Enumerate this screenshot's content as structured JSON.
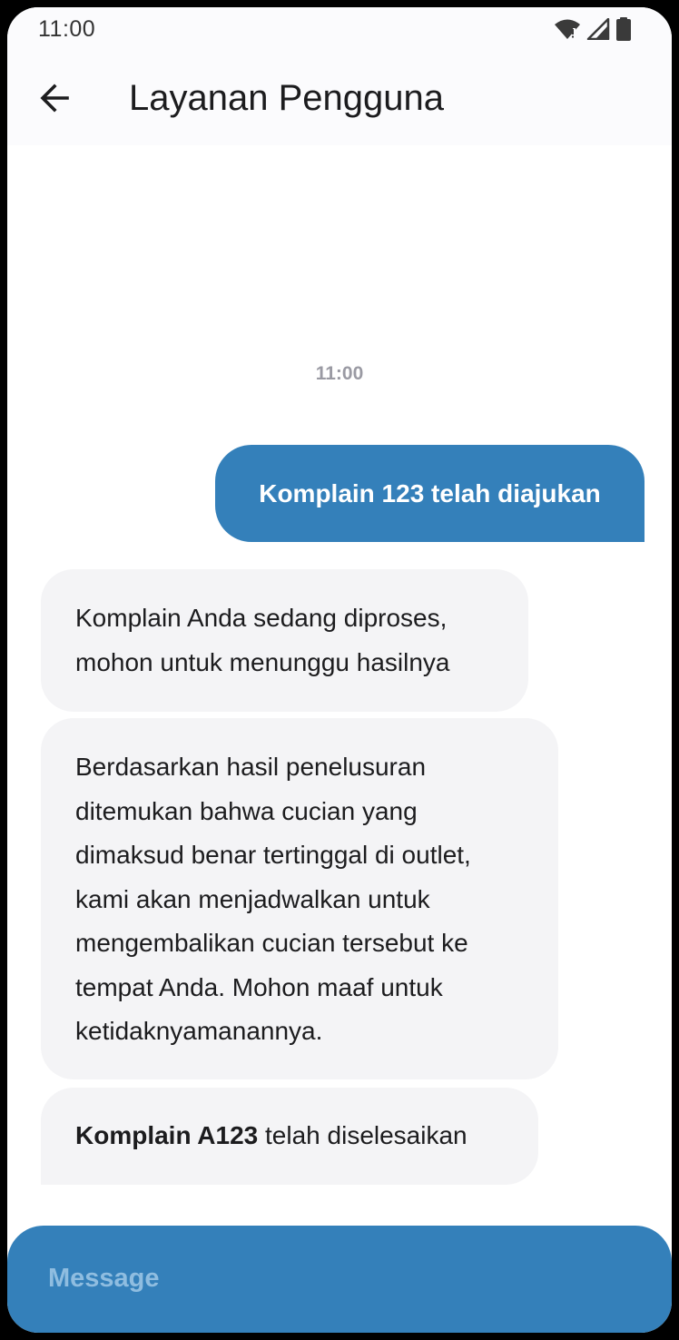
{
  "status_bar": {
    "time": "11:00",
    "icons": [
      "wifi-icon",
      "signal-icon",
      "battery-icon"
    ]
  },
  "app_bar": {
    "back_icon": "arrow-left-icon",
    "title": "Layanan Pengguna"
  },
  "chat": {
    "timestamp": "11:00",
    "outgoing": [
      {
        "text": "Komplain 123 telah diajukan"
      }
    ],
    "incoming": [
      {
        "lines": [
          "Komplain Anda sedang diproses,",
          "mohon untuk menunggu hasilnya"
        ]
      },
      {
        "lines": [
          "Berdasarkan hasil penelusuran",
          "ditemukan bahwa cucian yang",
          "dimaksud benar tertinggal di outlet,",
          "kami akan menjadwalkan untuk",
          "mengembalikan cucian tersebut ke",
          "tempat Anda. Mohon maaf untuk",
          "ketidaknyamanannya."
        ]
      },
      {
        "strong": "Komplain A123",
        "rest": " telah diselesaikan"
      }
    ]
  },
  "composer": {
    "placeholder": "Message",
    "value": ""
  },
  "colors": {
    "accent": "#3480ba",
    "incoming_bubble": "#f4f4f6",
    "placeholder": "#8fbde0"
  }
}
